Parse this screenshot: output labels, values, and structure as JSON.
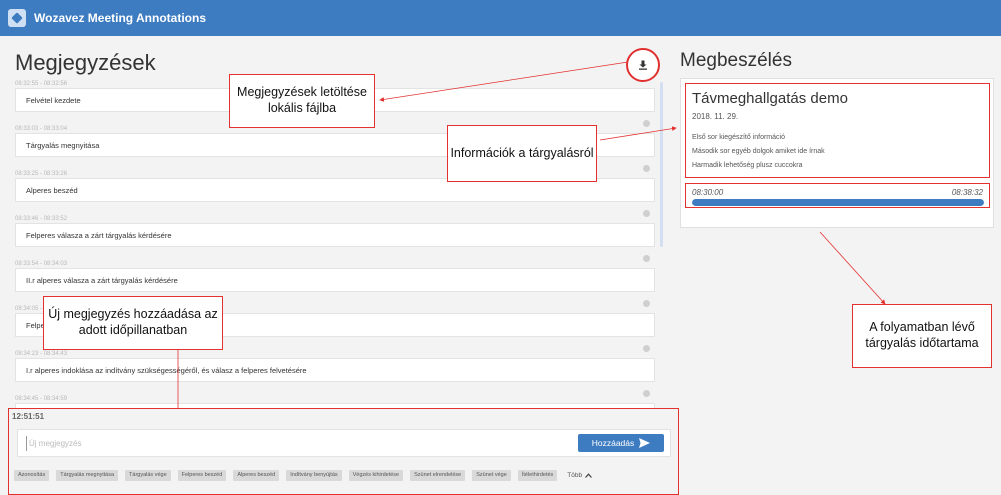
{
  "app": {
    "title": "Wozavez Meeting Annotations"
  },
  "notes_panel": {
    "title": "Megjegyzések",
    "items": [
      {
        "time": "08:32:55 - 08:32:56",
        "text": "Felvétel kezdete"
      },
      {
        "time": "08:33:03 - 08:33:04",
        "text": "Tárgyalás megnyitása"
      },
      {
        "time": "08:33:25 - 08:33:26",
        "text": "Alperes beszéd"
      },
      {
        "time": "08:33:46 - 08:33:52",
        "text": "Felperes válasza a zárt tárgyalás kérdésére"
      },
      {
        "time": "08:33:54 - 08:34:03",
        "text": "II.r alperes válasza a zárt tárgyalás kérdésére"
      },
      {
        "time": "08:34:05 - 08:34:11",
        "text": "Felperes"
      },
      {
        "time": "08:34:23 - 08:34:43",
        "text": "I.r alperes indoklása az indítvány szükségességéről, és válasz a felperes felvetésére"
      },
      {
        "time": "08:34:45 - 08:34:59",
        "text": ""
      }
    ]
  },
  "meeting_panel": {
    "title": "Megbeszélés",
    "hearing_title": "Távmeghallgatás demo",
    "date": "2018. 11. 29.",
    "info_lines": [
      "Első sor kiegészítő információ",
      "Második sor egyéb dolgok amiket ide írnak",
      "Harmadik lehetőség plusz cuccokra"
    ],
    "time_start": "08:30:00",
    "time_end": "08:38:32",
    "progress": 1.0
  },
  "composer": {
    "clock": "12:51:51",
    "placeholder": "Új megjegyzés",
    "add_label": "Hozzáadás",
    "quick_tags": [
      "Azonosítás",
      "Tárgyalás megnyitása",
      "Tárgyalás vége",
      "Felperes beszéd",
      "Alperes beszéd",
      "Indítvány benyújtás",
      "Végzés kihirdetése",
      "Szünet elrendelése",
      "Szünet vége",
      "Ítélethirdetés"
    ],
    "more_label": "Több"
  },
  "callouts": {
    "download": "Megjegyzések letöltése lokális fájlba",
    "info": "Információk a tárgyalásról",
    "duration": "A folyamatban lévő tárgyalás időtartama",
    "new_note": "Új megjegyzés hozzáadása az adott időpillanatban"
  },
  "colors": {
    "accent": "#3d7cc0",
    "annotation_red": "#e53030"
  },
  "icons": {
    "download": "download-icon",
    "send": "send-icon",
    "chevron": "chevron-up-icon",
    "logo": "app-logo-icon"
  }
}
